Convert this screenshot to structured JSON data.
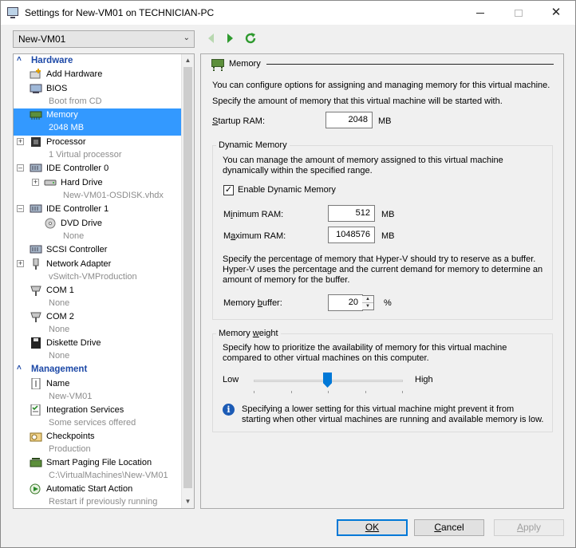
{
  "window": {
    "title": "Settings for New-VM01 on TECHNICIAN-PC",
    "controls": {
      "minimize": "minimize-icon",
      "maximize": "maximize-icon",
      "close": "close-icon"
    }
  },
  "vm_select": {
    "value": "New-VM01"
  },
  "toolbar": {
    "icons": [
      "back-arrow-icon",
      "forward-arrow-icon",
      "refresh-icon"
    ]
  },
  "tree": {
    "hardware_label": "Hardware",
    "management_label": "Management",
    "hardware_items": [
      {
        "label": "Add Hardware",
        "sub": ""
      },
      {
        "label": "BIOS",
        "sub": "Boot from CD"
      },
      {
        "label": "Memory",
        "sub": "2048 MB"
      },
      {
        "label": "Processor",
        "sub": "1 Virtual processor"
      },
      {
        "label": "IDE Controller 0",
        "sub": ""
      },
      {
        "label": "Hard Drive",
        "sub": "New-VM01-OSDISK.vhdx"
      },
      {
        "label": "IDE Controller 1",
        "sub": ""
      },
      {
        "label": "DVD Drive",
        "sub": "None"
      },
      {
        "label": "SCSI Controller",
        "sub": ""
      },
      {
        "label": "Network Adapter",
        "sub": "vSwitch-VMProduction"
      },
      {
        "label": "COM 1",
        "sub": "None"
      },
      {
        "label": "COM 2",
        "sub": "None"
      },
      {
        "label": "Diskette Drive",
        "sub": "None"
      }
    ],
    "management_items": [
      {
        "label": "Name",
        "sub": "New-VM01"
      },
      {
        "label": "Integration Services",
        "sub": "Some services offered"
      },
      {
        "label": "Checkpoints",
        "sub": "Production"
      },
      {
        "label": "Smart Paging File Location",
        "sub": "C:\\VirtualMachines\\New-VM01"
      },
      {
        "label": "Automatic Start Action",
        "sub": "Restart if previously running"
      }
    ]
  },
  "memory": {
    "header": "Memory",
    "intro1": "You can configure options for assigning and managing memory for this virtual machine.",
    "intro2": "Specify the amount of memory that this virtual machine will be started with.",
    "startup_label": "Startup RAM:",
    "startup_value": "2048",
    "unit_mb": "MB",
    "dynamic": {
      "title": "Dynamic Memory",
      "desc1": "You can manage the amount of memory assigned to this virtual machine",
      "desc2": "dynamically within the specified range.",
      "enable_label": "Enable Dynamic Memory",
      "enabled": true,
      "min_label": "Minimum RAM:",
      "min_value": "512",
      "max_label": "Maximum RAM:",
      "max_value": "1048576",
      "buffer_desc1": "Specify the percentage of memory that Hyper-V should try to reserve as a buffer.",
      "buffer_desc2": "Hyper-V uses the percentage and the current demand for memory to determine an",
      "buffer_desc3": "amount of memory for the buffer.",
      "buffer_label": "Memory buffer:",
      "buffer_value": "20",
      "buffer_unit": "%"
    },
    "weight": {
      "title": "Memory weight",
      "desc1": "Specify how to prioritize the availability of memory for this virtual machine",
      "desc2": "compared to other virtual machines on this computer.",
      "low_label": "Low",
      "high_label": "High",
      "slider_level": 0.5,
      "info1": "Specifying a lower setting for this virtual machine might prevent it from",
      "info2": "starting when other virtual machines are running and available memory is low."
    }
  },
  "buttons": {
    "ok": "OK",
    "cancel": "Cancel",
    "apply": "Apply"
  },
  "colors": {
    "selection": "#3399ff",
    "section_header": "#1d49a7",
    "accent": "#0078d7"
  }
}
